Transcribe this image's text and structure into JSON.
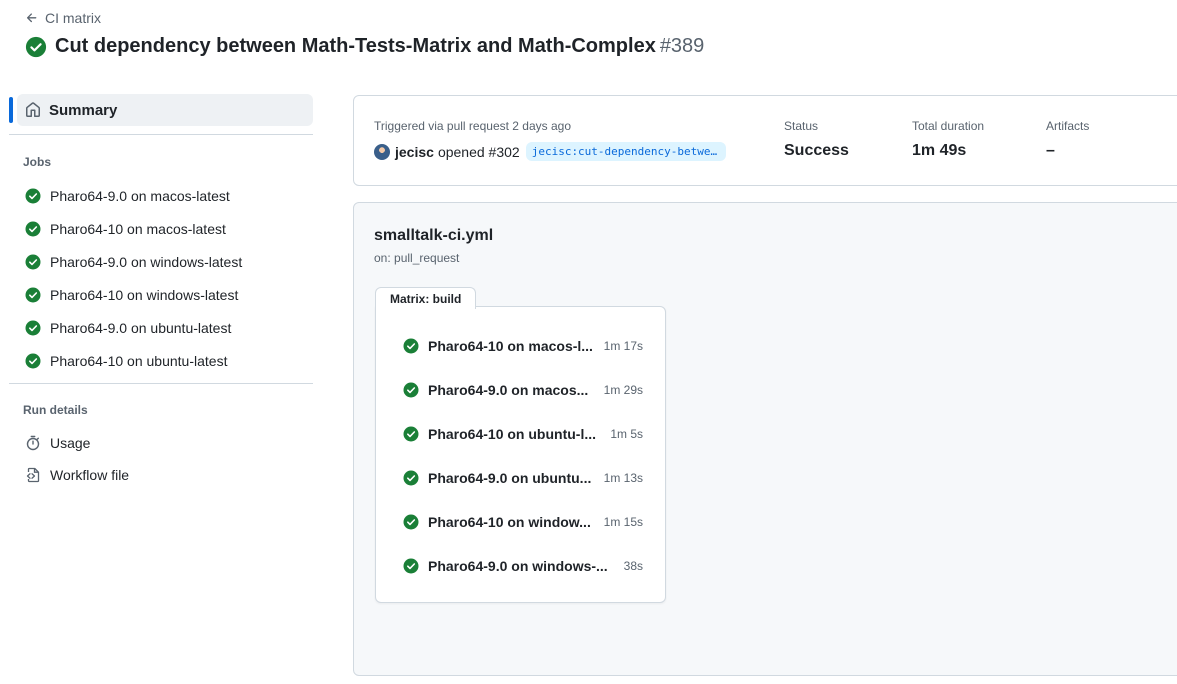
{
  "breadcrumb": {
    "label": "CI matrix"
  },
  "header": {
    "title": "Cut dependency between Math-Tests-Matrix and Math-Complex",
    "run_number": "#389"
  },
  "sidebar": {
    "summary_label": "Summary",
    "jobs_title": "Jobs",
    "jobs": [
      {
        "label": "Pharo64-9.0 on macos-latest"
      },
      {
        "label": "Pharo64-10 on macos-latest"
      },
      {
        "label": "Pharo64-9.0 on windows-latest"
      },
      {
        "label": "Pharo64-10 on windows-latest"
      },
      {
        "label": "Pharo64-9.0 on ubuntu-latest"
      },
      {
        "label": "Pharo64-10 on ubuntu-latest"
      }
    ],
    "run_details_title": "Run details",
    "run_details": [
      {
        "label": "Usage",
        "icon": "stopwatch-icon"
      },
      {
        "label": "Workflow file",
        "icon": "file-code-icon"
      }
    ]
  },
  "summary": {
    "trigger_text": "Triggered via pull request 2 days ago",
    "actor": "jecisc",
    "action": "opened #302",
    "branch": "jecisc:cut-dependency-between-Math-Tests-Matrix-and-Math-Complex",
    "status_label": "Status",
    "status_value": "Success",
    "duration_label": "Total duration",
    "duration_value": "1m 49s",
    "artifacts_label": "Artifacts",
    "artifacts_value": "–"
  },
  "workflow": {
    "name": "smalltalk-ci.yml",
    "trigger": "on: pull_request",
    "matrix_title": "Matrix: build",
    "matrix_jobs": [
      {
        "name": "Pharo64-10 on macos-latest",
        "display": "Pharo64-10 on macos-l...",
        "duration": "1m 17s"
      },
      {
        "name": "Pharo64-9.0 on macos-latest",
        "display": "Pharo64-9.0 on macos...",
        "duration": "1m 29s"
      },
      {
        "name": "Pharo64-10 on ubuntu-latest",
        "display": "Pharo64-10 on ubuntu-l...",
        "duration": "1m 5s"
      },
      {
        "name": "Pharo64-9.0 on ubuntu-latest",
        "display": "Pharo64-9.0 on ubuntu...",
        "duration": "1m 13s"
      },
      {
        "name": "Pharo64-10 on windows-latest",
        "display": "Pharo64-10 on window...",
        "duration": "1m 15s"
      },
      {
        "name": "Pharo64-9.0 on windows-latest",
        "display": "Pharo64-9.0 on windows-...",
        "duration": "38s"
      }
    ]
  },
  "colors": {
    "success": "#1a7f37",
    "accent": "#0969da",
    "muted": "#59636e",
    "border": "#d1d9e0"
  }
}
